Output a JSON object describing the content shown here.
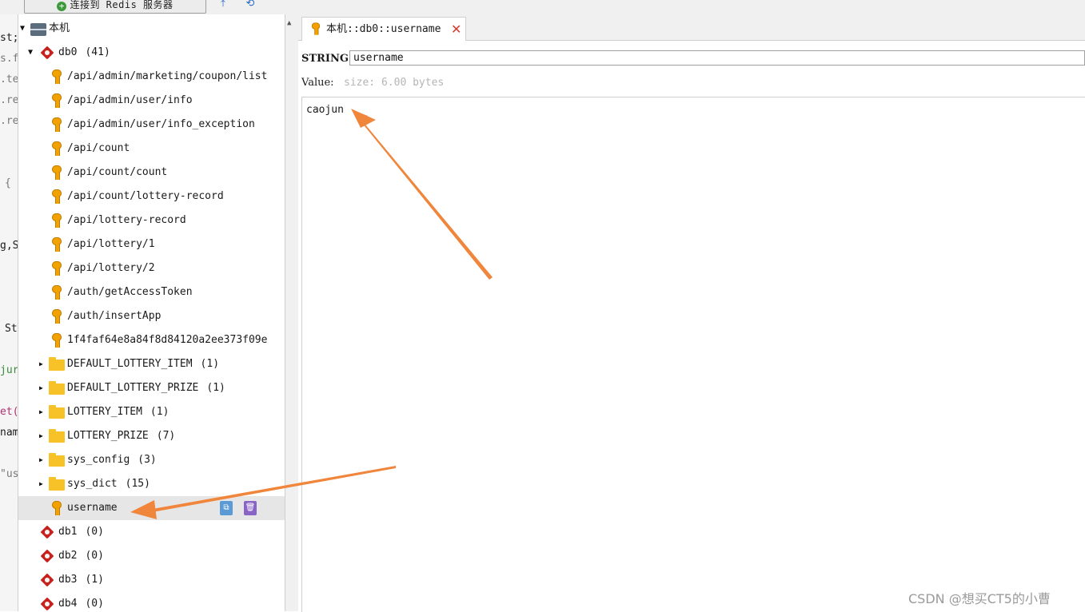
{
  "toolbar": {
    "connect_label": "连接到 Redis 服务器"
  },
  "code_strip": [
    "st;",
    "s.f",
    ".te",
    ".re",
    ".re",
    "{",
    "g,S",
    "St",
    "jur",
    "et(",
    "nam",
    "\"us"
  ],
  "tree": {
    "root_label": "本机",
    "db0": {
      "label": "db0",
      "count": "(41)"
    },
    "keys": [
      "/api/admin/marketing/coupon/list",
      "/api/admin/user/info",
      "/api/admin/user/info_exception",
      "/api/count",
      "/api/count/count",
      "/api/count/lottery-record",
      "/api/lottery-record",
      "/api/lottery/1",
      "/api/lottery/2",
      "/auth/getAccessToken",
      "/auth/insertApp",
      "1f4faf64e8a84f8d84120a2ee373f09e"
    ],
    "folders": [
      {
        "label": "DEFAULT_LOTTERY_ITEM",
        "count": "(1)"
      },
      {
        "label": "DEFAULT_LOTTERY_PRIZE",
        "count": "(1)"
      },
      {
        "label": "LOTTERY_ITEM",
        "count": "(1)"
      },
      {
        "label": "LOTTERY_PRIZE",
        "count": "(7)"
      },
      {
        "label": "sys_config",
        "count": "(3)"
      },
      {
        "label": "sys_dict",
        "count": "(15)"
      }
    ],
    "selected_key": "username",
    "dbs": [
      {
        "label": "db1",
        "count": "(0)"
      },
      {
        "label": "db2",
        "count": "(0)"
      },
      {
        "label": "db3",
        "count": "(1)"
      },
      {
        "label": "db4",
        "count": "(0)"
      }
    ]
  },
  "tab": {
    "label": "本机::db0::username"
  },
  "editor": {
    "type_label": "STRING:",
    "key_value": "username",
    "value_label": "Value:",
    "size_text": "size: 6.00 bytes",
    "value_text": "caojun"
  },
  "watermark": "CSDN @想买CT5的小曹",
  "colors": {
    "arrow": "#f0863c",
    "key": "#f2a200",
    "folder": "#f6c228",
    "db": "#c8211d",
    "close": "#d83a2b"
  }
}
